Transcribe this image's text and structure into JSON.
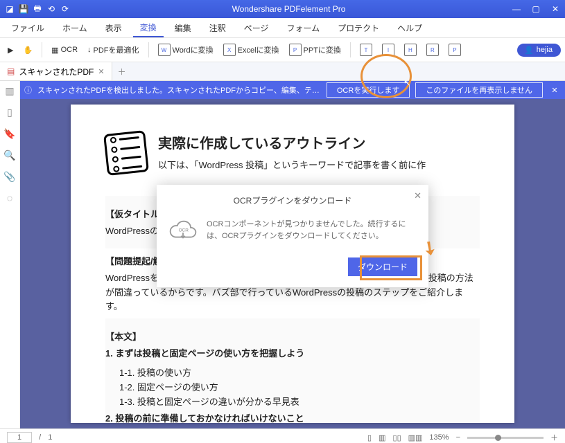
{
  "titlebar": {
    "title": "Wondershare PDFelement Pro"
  },
  "menu": {
    "items": [
      "ファイル",
      "ホーム",
      "表示",
      "変換",
      "編集",
      "注釈",
      "ページ",
      "フォーム",
      "プロテクト",
      "ヘルプ"
    ],
    "active": "変換"
  },
  "toolbar": {
    "ocr": "OCR",
    "optimize": "PDFを最適化",
    "toword": "Wordに変換",
    "toexcel": "Excelに変換",
    "toppt": "PPTに変換",
    "icon_t": "T",
    "icon_i": "I",
    "icon_h": "H",
    "icon_r": "R",
    "icon_p": "P",
    "user": "hejia"
  },
  "tab": {
    "name": "スキャンされたPDF"
  },
  "sidebar": {
    "icons": [
      "thumb",
      "page",
      "bookmark",
      "search",
      "attach",
      "sig"
    ]
  },
  "banner": {
    "text": "スキャンされたPDFを検出しました。スキャンされたPDFからコピー、編集、テキストを検索するためにはOCR機能...",
    "btn1": "OCRを実行します",
    "btn2": "このファイルを再表示しません"
  },
  "page": {
    "h1": "実際に作成しているアウトライン",
    "intro": "以下は、「WordPress 投稿」というキーワードで記事を書く前に作",
    "title_sec": "【仮タイトル】",
    "title_body": "WordPressの                                                                                       る",
    "problem_h": "【問題提起/解決策の提示/解決策の根拠】",
    "problem_body": "WordPressを使っても検索順位が上がらない、、、だとしたらその理由の大部分は投稿の方法が間違っているからです。バズ部で行っているWordPressの投稿のステップをご紹介します。",
    "body_h": "【本文】",
    "list1": "1. まずは投稿と固定ページの使い方を把握しよう",
    "list1a": "1-1. 投稿の使い方",
    "list1b": "1-2. 固定ページの使い方",
    "list1c": "1-3. 投稿と固定ページの違いが分かる早見表",
    "list2": "2. 投稿の前に準備しておかなければいけないこと"
  },
  "dialog": {
    "title": "OCRプラグインをダウンロード",
    "body": "OCRコンポーネントが見つかりませんでした。続行するには、OCRプラグインをダウンロードしてください。",
    "cloud_label": "OCR",
    "button": "ダウンロード"
  },
  "status": {
    "page_cur": "1",
    "page_sep": "/",
    "page_total": "1",
    "zoom": "135%"
  }
}
